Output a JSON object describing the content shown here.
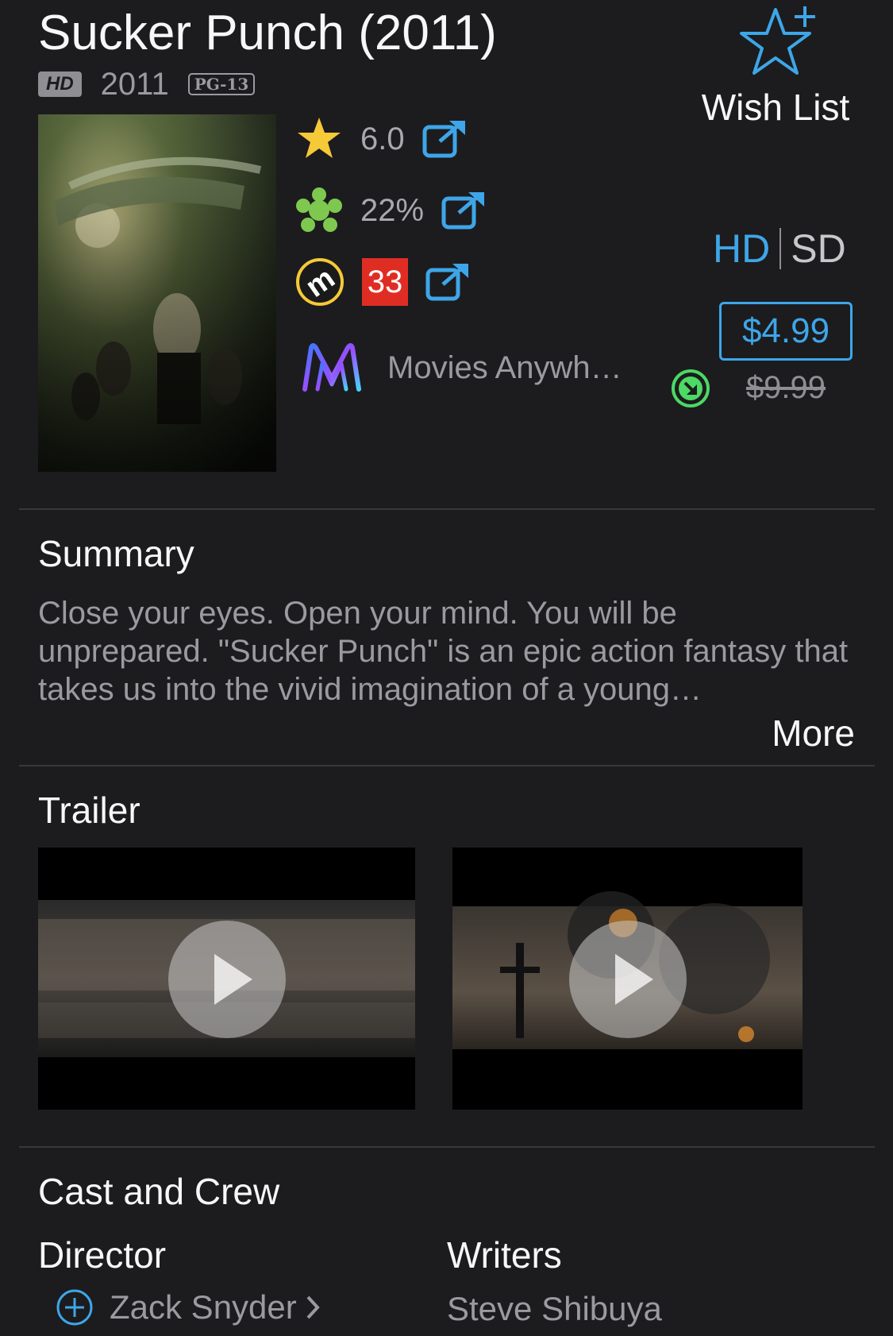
{
  "movie": {
    "title": "Sucker Punch (2011)",
    "hd_badge": "HD",
    "year": "2011",
    "rating": "PG-13"
  },
  "wish_list": {
    "label": "Wish List",
    "icon": "star-plus-icon"
  },
  "scores": {
    "imdb": {
      "value": "6.0",
      "icon": "star-icon"
    },
    "rotten_tomatoes": {
      "value": "22%",
      "icon": "splat-icon"
    },
    "metacritic": {
      "value": "33",
      "icon": "metacritic-icon"
    }
  },
  "movies_anywhere": {
    "label": "Movies Anywh…",
    "icon": "movies-anywhere-icon"
  },
  "format": {
    "hd": "HD",
    "sd": "SD",
    "selected": "HD"
  },
  "price": {
    "current": "$4.99",
    "original": "$9.99"
  },
  "summary": {
    "heading": "Summary",
    "text": "Close your eyes. Open your mind. You will be unprepared. \"Sucker Punch\" is an epic action fantasy that takes us into the vivid imagination of a young…",
    "more": "More"
  },
  "trailer": {
    "heading": "Trailer"
  },
  "cast": {
    "heading": "Cast and Crew",
    "director_label": "Director",
    "director_name": "Zack Snyder",
    "writers_label": "Writers",
    "writer_name": "Steve Shibuya"
  },
  "colors": {
    "accent": "#3ea6e8",
    "background": "#1c1c1e",
    "metacritic": "#e02d24",
    "download": "#4cd964"
  }
}
